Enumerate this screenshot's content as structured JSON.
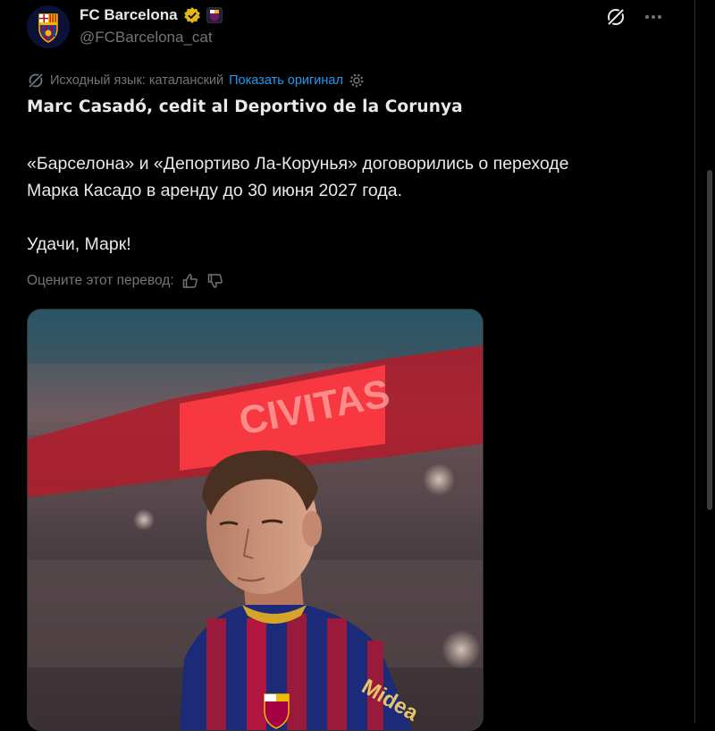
{
  "account": {
    "name": "FC Barcelona",
    "handle": "@FCBarcelona_cat",
    "verified": true
  },
  "header_icons": [
    "grok-icon",
    "more-options-icon"
  ],
  "translation": {
    "source_label": "Исходный язык: каталанский",
    "show_original": "Показать оригинал"
  },
  "original_title": "Marc Casadó, cedit al Deportivo de la Corunya",
  "body": {
    "line1": "«Барселона» и «Депортиво Ла-Корунья» договорились о переходе",
    "line2": "Марка Касадо в аренду до 30 июня 2027 года.",
    "line3": "Удачи, Марк!"
  },
  "rating": {
    "label": "Оцените этот перевод:"
  },
  "media": {
    "alt": "Marc Casadó in FC Barcelona kit",
    "sponsor_text": "Midea"
  },
  "colors": {
    "background": "#000000",
    "text": "#e7e9ea",
    "muted": "#71767b",
    "link": "#1d9bf0",
    "verified_badge": "#e2b719"
  }
}
